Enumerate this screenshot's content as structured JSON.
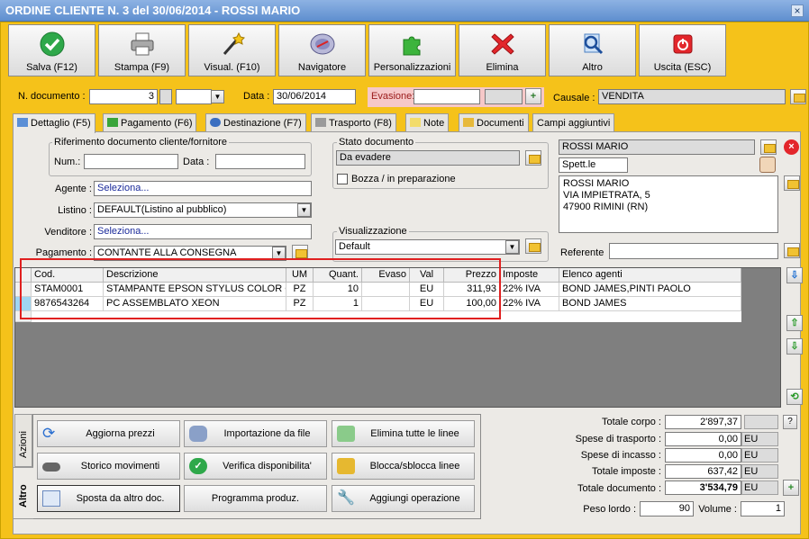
{
  "window": {
    "title": "ORDINE CLIENTE N. 3 del 30/06/2014 - ROSSI MARIO",
    "close": "×"
  },
  "toolbar": [
    {
      "label": "Salva (F12)",
      "icon": "check-icon"
    },
    {
      "label": "Stampa (F9)",
      "icon": "printer-icon"
    },
    {
      "label": "Visual. (F10)",
      "icon": "magic-wand-icon"
    },
    {
      "label": "Navigatore",
      "icon": "compass-icon"
    },
    {
      "label": "Personalizzazioni",
      "icon": "puzzle-icon"
    },
    {
      "label": "Elimina",
      "icon": "delete-x-icon"
    },
    {
      "label": "Altro",
      "icon": "magnifier-icon"
    },
    {
      "label": "Uscita (ESC)",
      "icon": "power-icon"
    }
  ],
  "header": {
    "ndoc_label": "N. documento :",
    "ndoc_value": "3",
    "ndoc_suffix": "",
    "data_label": "Data :",
    "data_value": "30/06/2014",
    "evasione_label": "Evasione:",
    "evasione_value": "",
    "evasione_time": "",
    "causale_label": "Causale :",
    "causale_value": "VENDITA"
  },
  "tabs": [
    {
      "label": "Dettaglio (F5)",
      "active": true
    },
    {
      "label": "Pagamento (F6)"
    },
    {
      "label": "Destinazione (F7)"
    },
    {
      "label": "Trasporto (F8)"
    },
    {
      "label": "Note"
    },
    {
      "label": "Documenti"
    },
    {
      "label": "Campi aggiuntivi"
    }
  ],
  "rif": {
    "title": "Riferimento documento cliente/fornitore",
    "num_label": "Num.:",
    "num_value": "",
    "data_label": "Data :",
    "data_value": ""
  },
  "fields": {
    "agente_label": "Agente :",
    "agente_value": "Seleziona...",
    "listino_label": "Listino :",
    "listino_value": "DEFAULT(Listino al pubblico)",
    "venditore_label": "Venditore :",
    "venditore_value": "Seleziona...",
    "pagamento_label": "Pagamento :",
    "pagamento_value": "CONTANTE ALLA CONSEGNA"
  },
  "stato": {
    "title": "Stato documento",
    "value": "Da evadere",
    "bozza_label": "Bozza / in preparazione"
  },
  "visualizzazione": {
    "title": "Visualizzazione",
    "value": "Default"
  },
  "cliente": {
    "name": "ROSSI MARIO",
    "salutation": "Spett.le",
    "address": [
      "ROSSI MARIO",
      "VIA IMPIETRATA, 5",
      "47900 RIMINI (RN)"
    ],
    "referente_label": "Referente",
    "referente_value": ""
  },
  "grid": {
    "headers": [
      "Cod.",
      "Descrizione",
      "UM",
      "Quant.",
      "Evaso",
      "Val",
      "Prezzo",
      "Imposte",
      "Elenco agenti"
    ],
    "rows": [
      [
        "STAM0001",
        "STAMPANTE EPSON STYLUS COLOR C...",
        "PZ",
        "10",
        "",
        "EU",
        "311,93",
        "22% IVA",
        "BOND JAMES,PINTI PAOLO"
      ],
      [
        "9876543264",
        "PC ASSEMBLATO XEON",
        "PZ",
        "1",
        "",
        "EU",
        "100,00",
        "22% IVA",
        "BOND JAMES"
      ]
    ]
  },
  "sidetabs": {
    "azioni": "Azioni",
    "altro": "Altro"
  },
  "actions": [
    {
      "label": "Aggiorna prezzi",
      "icon": "refresh-icon"
    },
    {
      "label": "Importazione da file",
      "icon": "database-import-icon"
    },
    {
      "label": "Elimina tutte le linee",
      "icon": "recycle-bin-icon"
    },
    {
      "label": "Storico movimenti",
      "icon": "binoculars-icon"
    },
    {
      "label": "Verifica disponibilita'",
      "icon": "check-icon"
    },
    {
      "label": "Blocca/sblocca linee",
      "icon": "padlock-icon"
    },
    {
      "label": "Sposta da altro doc.",
      "icon": "move-doc-icon"
    },
    {
      "label": "Programma produz.",
      "icon": ""
    },
    {
      "label": "Aggiungi operazione",
      "icon": "wrench-icon"
    }
  ],
  "totals": {
    "corpo_label": "Totale corpo :",
    "corpo_value": "2'897,37",
    "help": "?",
    "trasporto_label": "Spese di trasporto :",
    "trasporto_value": "0,00",
    "incasso_label": "Spese di incasso :",
    "incasso_value": "0,00",
    "imposte_label": "Totale imposte :",
    "imposte_value": "637,42",
    "documento_label": "Totale documento :",
    "documento_value": "3'534,79",
    "currency": "EU",
    "peso_label": "Peso lordo :",
    "peso_value": "90",
    "volume_label": "Volume :",
    "volume_value": "1"
  },
  "highlight_color": "#e02020"
}
